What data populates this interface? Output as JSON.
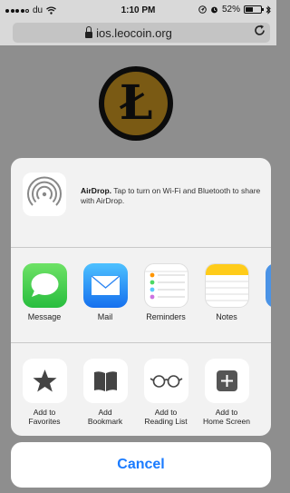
{
  "status": {
    "carrier": "du",
    "time": "1:10 PM",
    "battery_percent": "52%",
    "battery_level": 0.52,
    "signal_bars": 4,
    "signal_total": 5,
    "icons": [
      "wifi-icon",
      "location-icon",
      "alarm-icon",
      "bluetooth-icon"
    ]
  },
  "urlbar": {
    "url": "ios.leocoin.org",
    "reload_icon": "reload-icon"
  },
  "page": {
    "logo_glyph": "Ł"
  },
  "airdrop": {
    "title": "AirDrop.",
    "text": "Tap to turn on Wi-Fi and Bluetooth to share with AirDrop."
  },
  "apps": [
    {
      "label": "Message",
      "icon": "message-icon"
    },
    {
      "label": "Mail",
      "icon": "mail-icon"
    },
    {
      "label": "Reminders",
      "icon": "reminders-icon"
    },
    {
      "label": "Notes",
      "icon": "notes-icon"
    }
  ],
  "actions": [
    {
      "label": "Add to Favorites",
      "line1": "Add to",
      "line2": "Favorites",
      "icon": "star-icon"
    },
    {
      "label": "Add Bookmark",
      "line1": "Add",
      "line2": "Bookmark",
      "icon": "book-icon"
    },
    {
      "label": "Add to Reading List",
      "line1": "Add to",
      "line2": "Reading List",
      "icon": "glasses-icon"
    },
    {
      "label": "Add to Home Screen",
      "line1": "Add to",
      "line2": "Home Screen",
      "icon": "plus-icon"
    }
  ],
  "cancel_label": "Cancel",
  "colors": {
    "accent": "#1a7bff",
    "sheet_bg": "#f2f2f2",
    "dimmed_bg": "#8e8e8e"
  }
}
